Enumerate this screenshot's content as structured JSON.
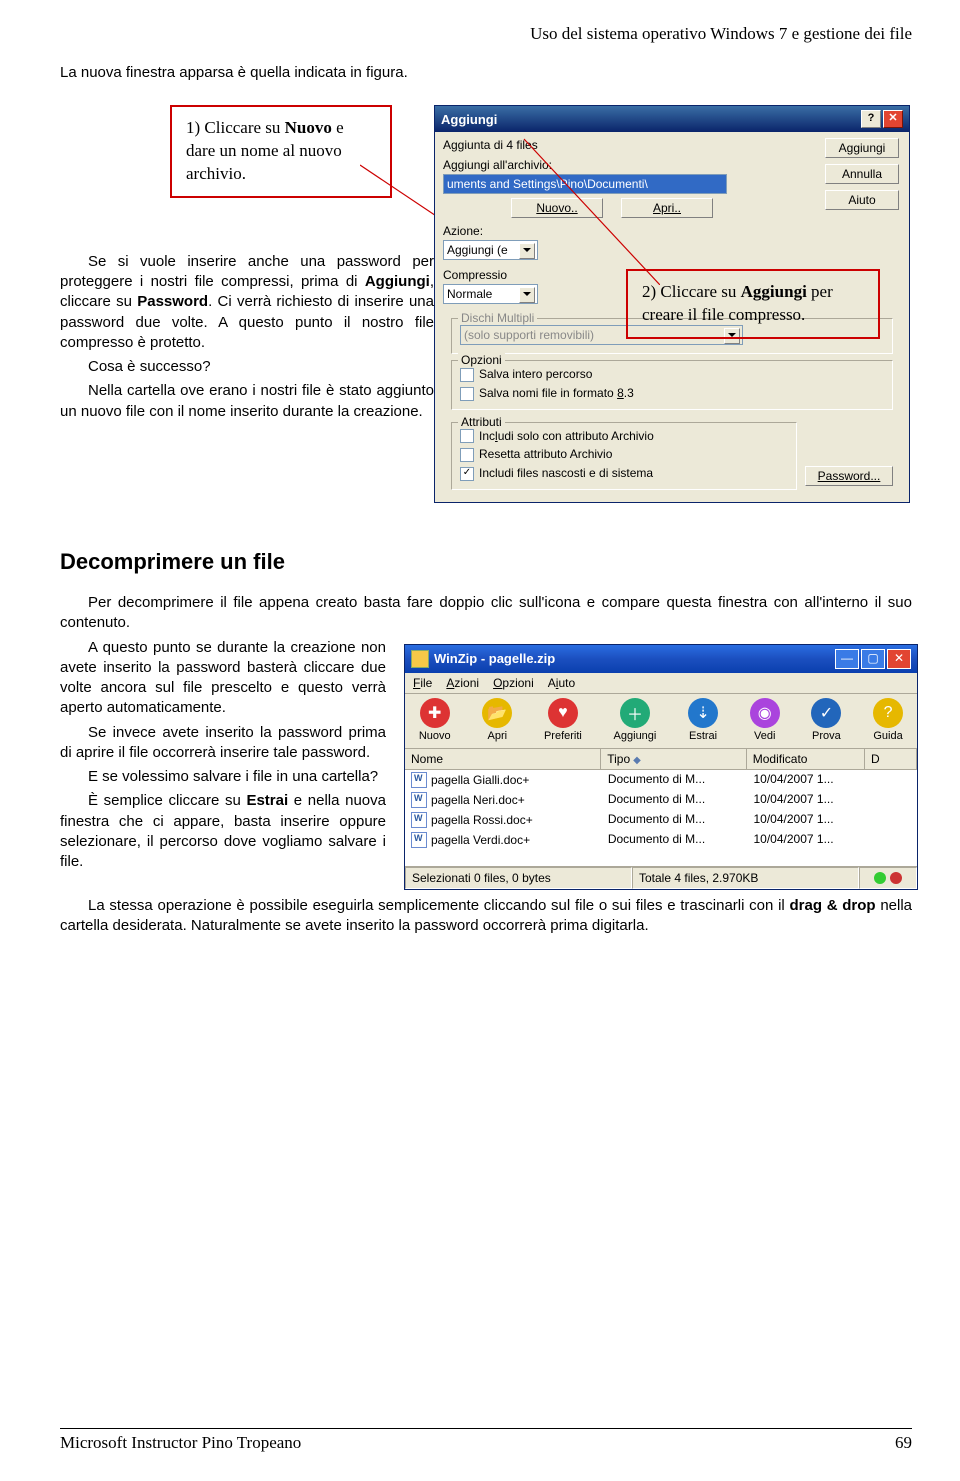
{
  "header": "Uso del sistema operativo Windows 7 e gestione dei file",
  "intro": "La nuova finestra apparsa è quella indicata in figura.",
  "callout1": {
    "pre": "1) Cliccare su ",
    "bold": "Nuovo",
    "post": " e dare un nome al nuovo archivio."
  },
  "callout2": {
    "pre": "2) Cliccare su ",
    "bold": "Aggiungi",
    "post": " per creare il file compresso."
  },
  "para1": {
    "a": "Se si vuole inserire anche una password per proteggere i nostri file compressi, prima di ",
    "b": "Aggiungi",
    "c": ", cliccare su ",
    "d": "Password",
    "e": ". Ci verrà richiesto di inserire una password due volte. A questo punto il nostro file compresso è protetto."
  },
  "para2": "Cosa è successo?",
  "para3": "Nella cartella ove erano i nostri file è stato aggiunto un nuovo file con il nome inserito durante la creazione.",
  "add_dialog": {
    "title": "Aggiungi",
    "row_info": "Aggiunta di 4 files",
    "lbl_path": "Aggiungi all'archivio:",
    "path_value": "uments and Settings\\Pino\\Documenti\\",
    "btn_nuovo": "Nuovo..",
    "btn_apri": "Apri..",
    "btn_aggiungi": "Aggiungi",
    "btn_annulla": "Annulla",
    "btn_aiuto": "Aiuto",
    "lbl_azione": "Azione:",
    "azione_val": "Aggiungi (e",
    "lbl_compressione": "Compressio",
    "lbl_normale": "Normale",
    "grp_dischi": "Dischi Multipli",
    "dischi_val": "(solo supporti removibili)",
    "grp_opzioni": "Opzioni",
    "opt1": "Salva intero percorso",
    "opt2": "Salva nomi file in formato 8.3",
    "grp_attributi": "Attributi",
    "att1": "Includi solo con attributo Archivio",
    "att2": "Resetta attributo Archivio",
    "att3": "Includi files nascosti e di sistema",
    "btn_pwd": "Password..."
  },
  "section_title": "Decomprimere un file",
  "decomp": {
    "p1": "Per decomprimere il file appena creato basta fare doppio clic sull'icona e compare questa finestra con all'interno il suo contenuto.",
    "p2": "A questo punto se durante la creazione non avete inserito la password basterà cliccare due volte ancora sul file prescelto e questo verrà aperto automaticamente.",
    "p3": "Se invece avete inserito la password prima di aprire il file occorrerà inserire tale password.",
    "p4": "E se volessimo salvare i file in una cartella?",
    "p5": {
      "a": "È semplice cliccare su ",
      "b": "Estrai",
      "c": " e nella nuova finestra che ci appare, basta inserire oppure selezionare, il percorso dove vogliamo salvare i file."
    },
    "p6": {
      "a": "La stessa operazione è possibile eseguirla semplicemente cliccando sul file o sui files e trascinarli con il ",
      "b": "drag & drop",
      "c": " nella cartella desiderata. Naturalmente se avete inserito la password occorrerà prima digitarla."
    }
  },
  "winzip": {
    "title": "WinZip - pagelle.zip",
    "menu": [
      "File",
      "Azioni",
      "Opzioni",
      "Aiuto"
    ],
    "toolbar": [
      {
        "label": "Nuovo",
        "bg": "#d33",
        "glyph": "✚"
      },
      {
        "label": "Apri",
        "bg": "#e6b800",
        "glyph": "📂"
      },
      {
        "label": "Preferiti",
        "bg": "#d33",
        "glyph": "♥"
      },
      {
        "label": "Aggiungi",
        "bg": "#2a7",
        "glyph": "＋"
      },
      {
        "label": "Estrai",
        "bg": "#27c",
        "glyph": "⇣"
      },
      {
        "label": "Vedi",
        "bg": "#a4d",
        "glyph": "◉"
      },
      {
        "label": "Prova",
        "bg": "#26b",
        "glyph": "✓"
      },
      {
        "label": "Guida",
        "bg": "#e6b800",
        "glyph": "?"
      }
    ],
    "cols": [
      "Nome",
      "Tipo",
      "Modificato",
      "D"
    ],
    "rows": [
      {
        "name": "pagella Gialli.doc+",
        "type": "Documento di M...",
        "mod": "10/04/2007 1..."
      },
      {
        "name": "pagella Neri.doc+",
        "type": "Documento di M...",
        "mod": "10/04/2007 1..."
      },
      {
        "name": "pagella Rossi.doc+",
        "type": "Documento di M...",
        "mod": "10/04/2007 1..."
      },
      {
        "name": "pagella Verdi.doc+",
        "type": "Documento di M...",
        "mod": "10/04/2007 1..."
      }
    ],
    "status_l": "Selezionati 0 files, 0 bytes",
    "status_r": "Totale 4 files, 2.970KB"
  },
  "footer": {
    "left": "Microsoft Instructor Pino Tropeano",
    "right": "69"
  }
}
